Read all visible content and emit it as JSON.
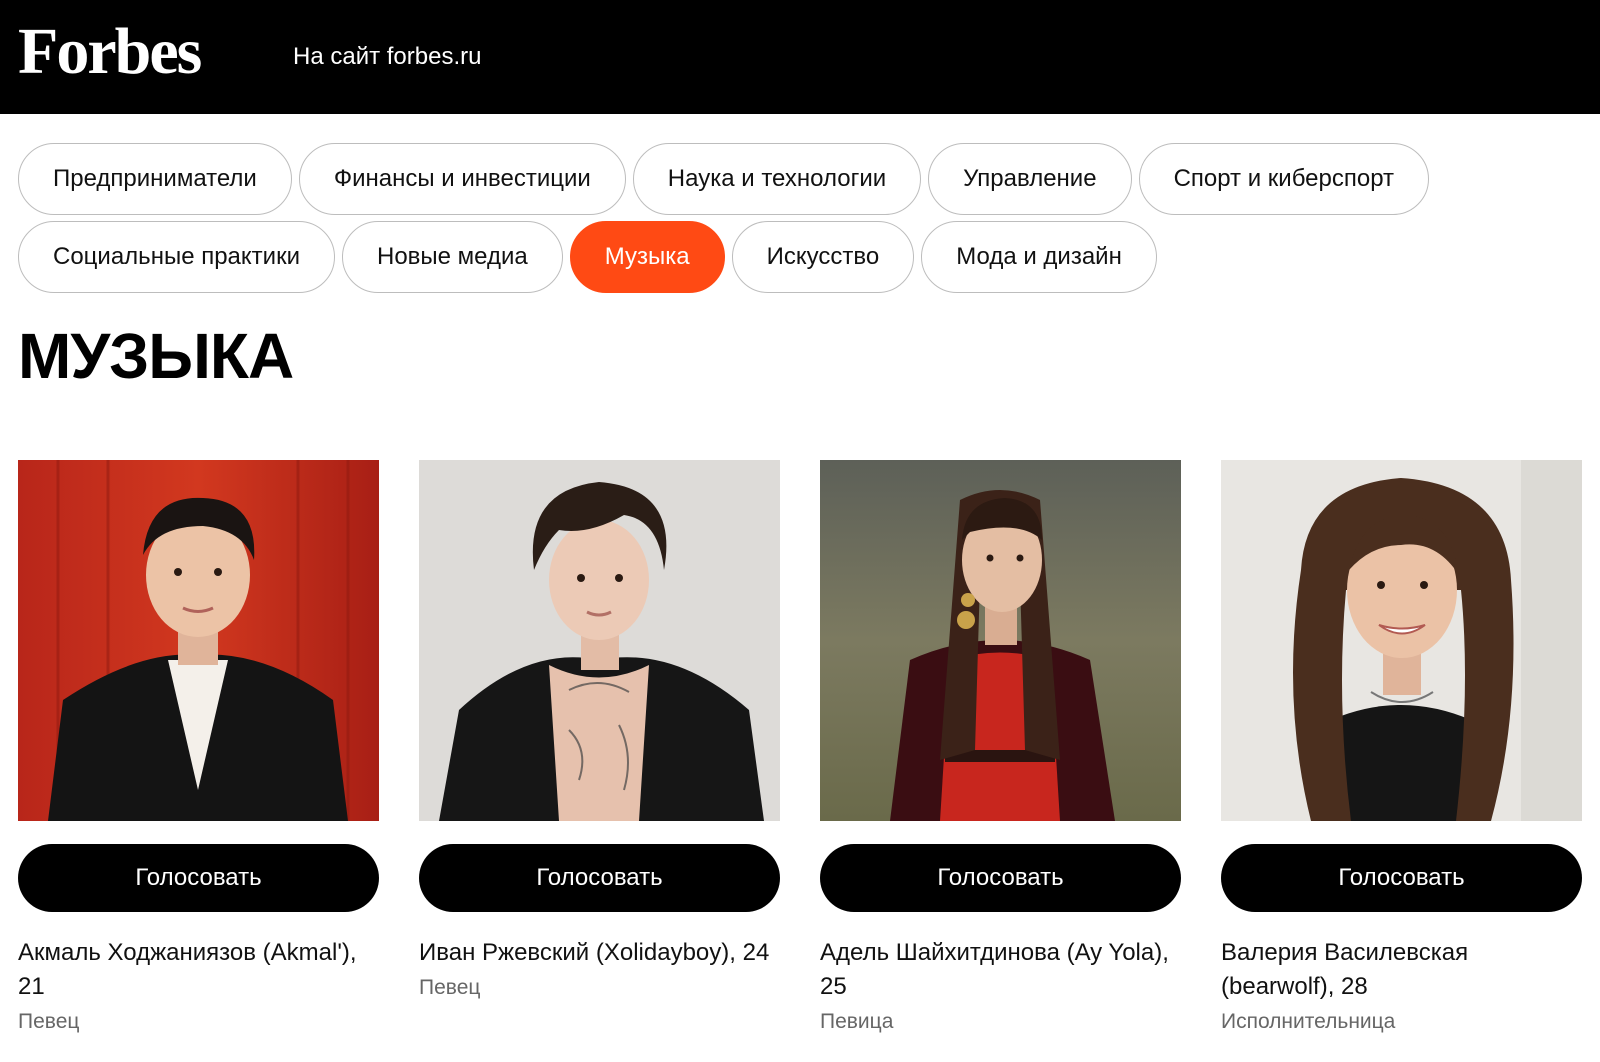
{
  "header": {
    "logo": "Forbes",
    "site_link": "На сайт forbes.ru"
  },
  "nav": {
    "rows": [
      [
        "Предприниматели",
        "Финансы и инвестиции",
        "Наука и технологии",
        "Управление",
        "Спорт и киберспорт"
      ],
      [
        "Социальные практики",
        "Новые медиа",
        "Музыка",
        "Искусство",
        "Мода и дизайн"
      ]
    ],
    "active": "Музыка"
  },
  "page_title": "МУЗЫКА",
  "vote_label": "Голосовать",
  "candidates": [
    {
      "name": "Акмаль Ходжаниязов (Akmal'), 21",
      "role": "Певец"
    },
    {
      "name": "Иван Ржевский (Xolidayboy), 24",
      "role": "Певец"
    },
    {
      "name": "Адель Шайхитдинова (Ay Yola), 25",
      "role": "Певица"
    },
    {
      "name": "Валерия Василевская (bearwolf), 28",
      "role": "Исполнительница"
    }
  ],
  "colors": {
    "accent": "#ff4a14",
    "header_bg": "#000000",
    "button_bg": "#000000"
  }
}
